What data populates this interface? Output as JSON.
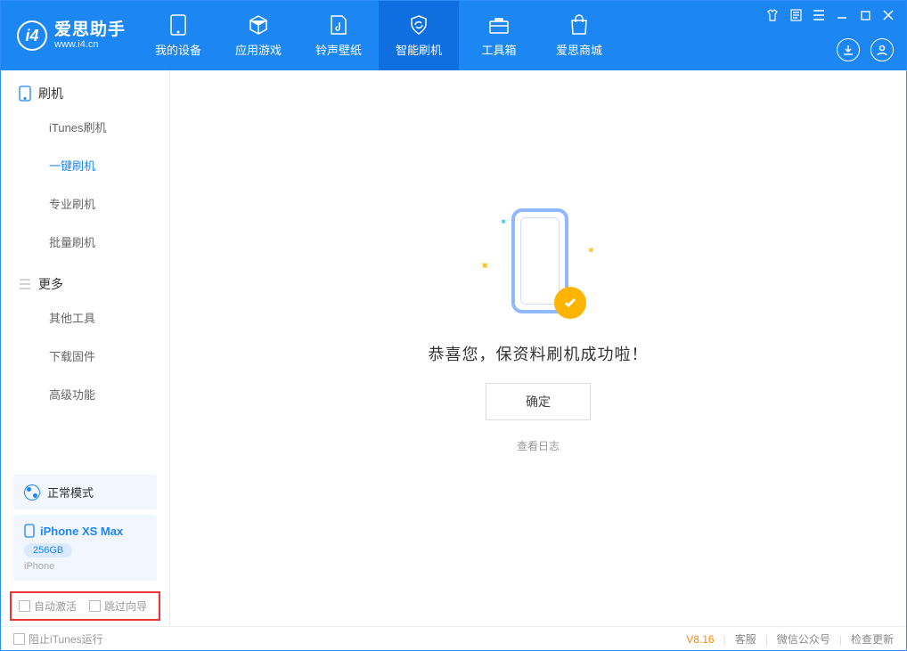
{
  "brand": {
    "cn": "爱思助手",
    "en": "www.i4.cn"
  },
  "nav": [
    {
      "label": "我的设备"
    },
    {
      "label": "应用游戏"
    },
    {
      "label": "铃声壁纸"
    },
    {
      "label": "智能刷机"
    },
    {
      "label": "工具箱"
    },
    {
      "label": "爱思商城"
    }
  ],
  "sidebar": {
    "group1": "刷机",
    "items1": [
      "iTunes刷机",
      "一键刷机",
      "专业刷机",
      "批量刷机"
    ],
    "group2": "更多",
    "items2": [
      "其他工具",
      "下载固件",
      "高级功能"
    ]
  },
  "mode": {
    "label": "正常模式"
  },
  "device": {
    "name": "iPhone XS Max",
    "storage": "256GB",
    "type": "iPhone"
  },
  "checks": {
    "auto_activate": "自动激活",
    "skip_guide": "跳过向导"
  },
  "main": {
    "message": "恭喜您，保资料刷机成功啦！",
    "ok": "确定",
    "view_log": "查看日志"
  },
  "footer": {
    "block_itunes": "阻止iTunes运行",
    "version": "V8.16",
    "support": "客服",
    "wechat": "微信公众号",
    "update": "检查更新"
  }
}
